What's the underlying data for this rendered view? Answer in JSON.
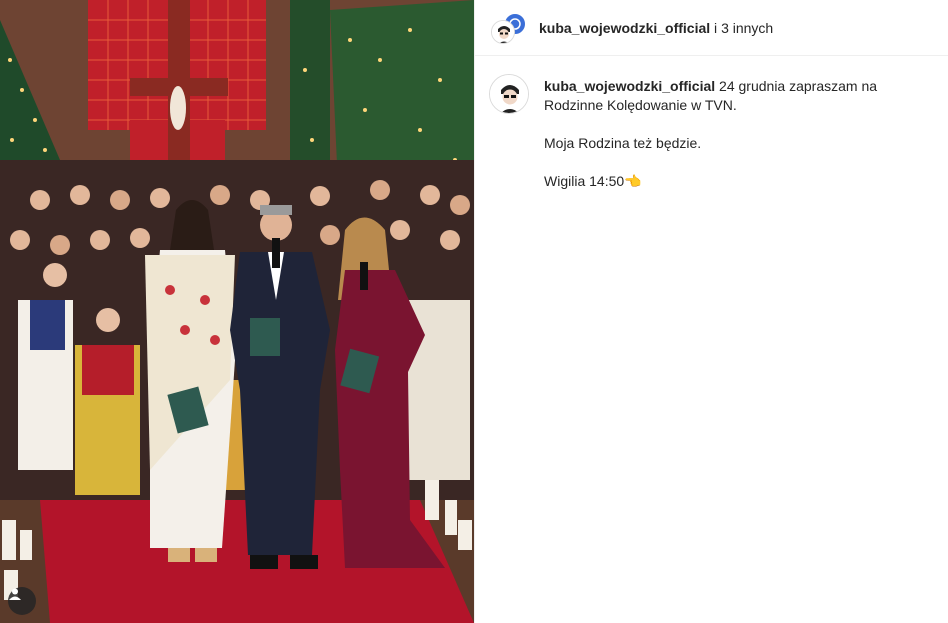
{
  "header": {
    "author": "kuba_wojewodzki_official",
    "conjunction": "i",
    "others": "3 innych"
  },
  "caption": {
    "author": "kuba_wojewodzki_official",
    "line1": "24 grudnia zapraszam na Rodzinne Kolędowanie w TVN.",
    "line2": "Moja Rodzina też będzie.",
    "line3": "Wigilia 14:50👈"
  },
  "icons": {
    "collab": "collab-avatar-icon",
    "user_tags": "person-icon"
  },
  "colors": {
    "carpet": "#b3142a",
    "dress_burgundy": "#7a1430",
    "suit_navy": "#1f2438"
  }
}
